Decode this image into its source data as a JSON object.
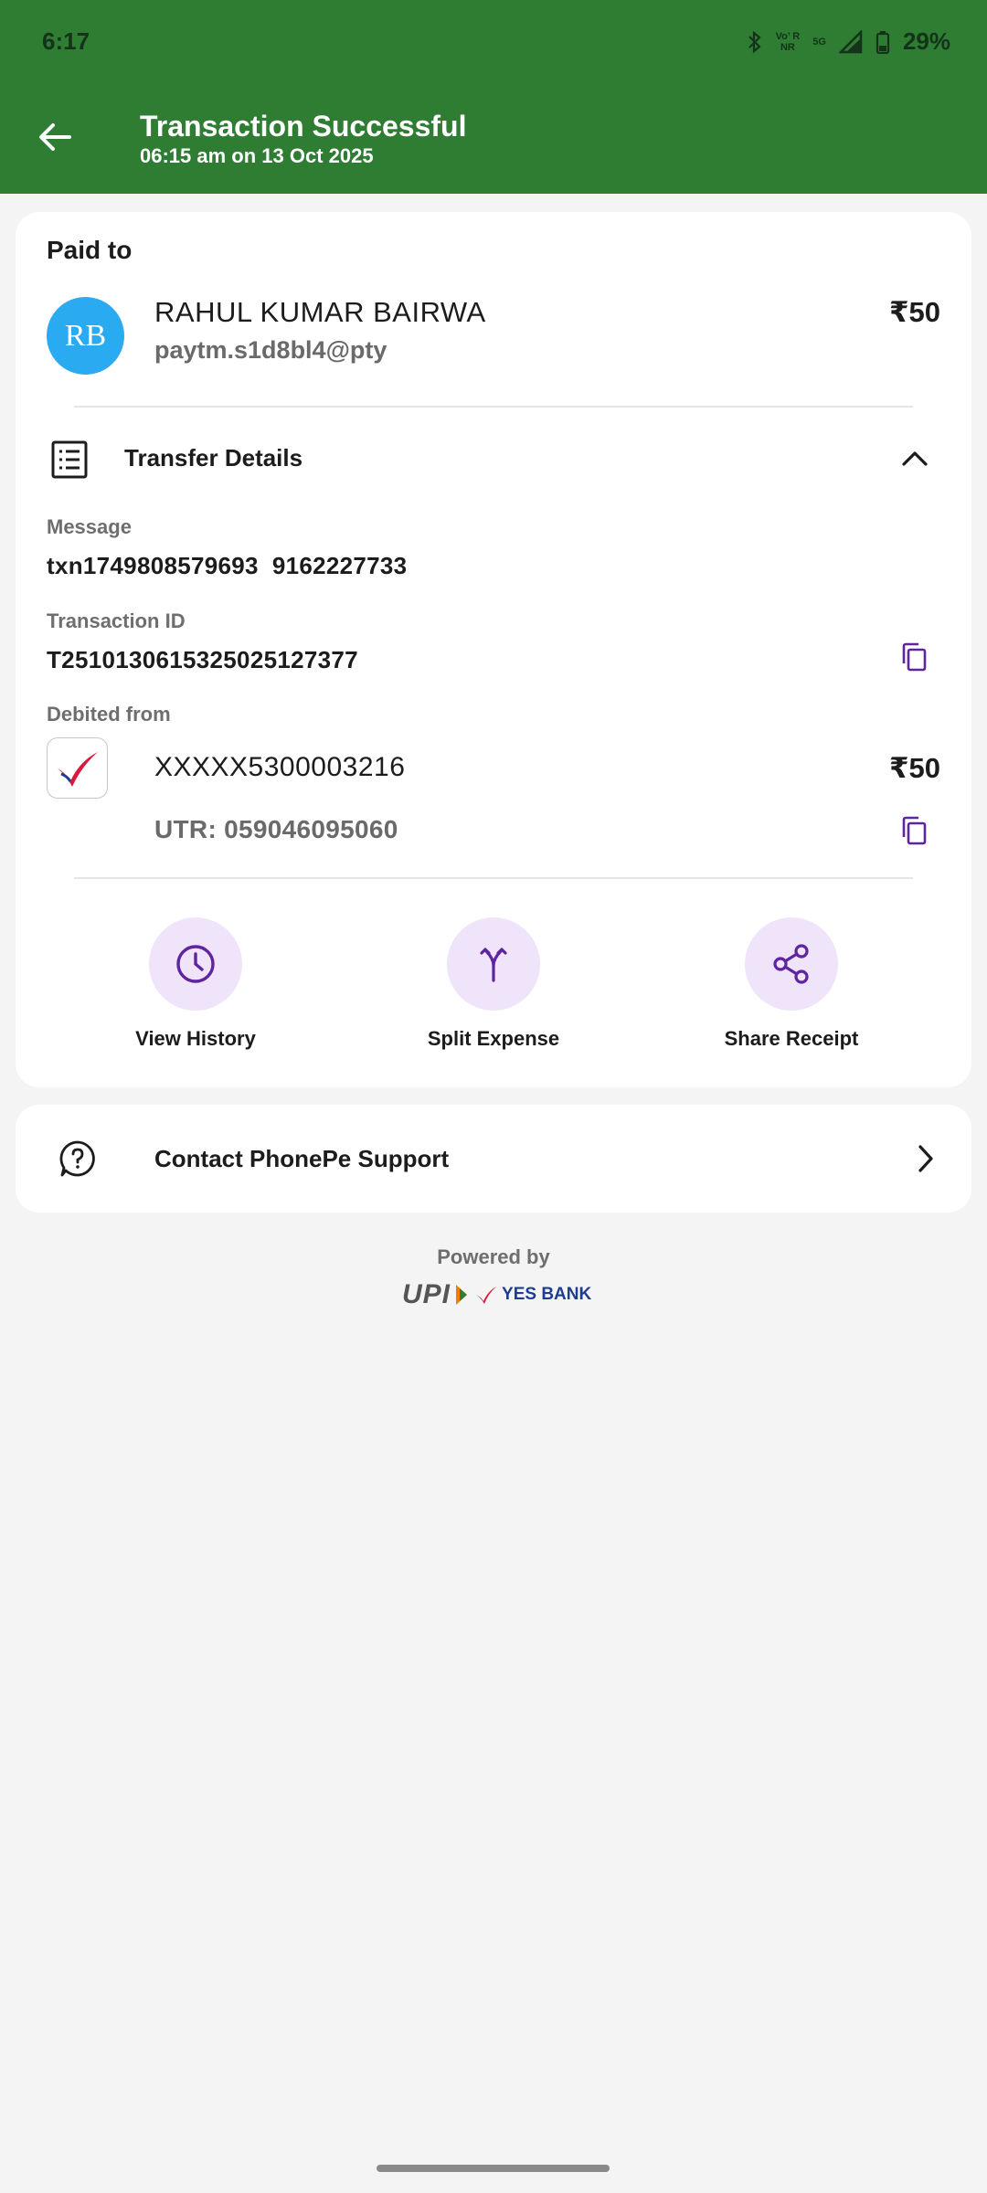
{
  "status_bar": {
    "time": "6:17",
    "network_small_top": "Vo’ R",
    "network_small_bottom": "NR",
    "network_5g": "5G",
    "battery": "29%"
  },
  "header": {
    "title": "Transaction Successful",
    "subtitle": "06:15 am on 13 Oct 2025"
  },
  "payee": {
    "section_label": "Paid to",
    "initials": "RB",
    "name": "RAHUL KUMAR BAIRWA",
    "vpa": "paytm.s1d8bl4@pty",
    "amount": "₹50"
  },
  "transfer_details": {
    "title": "Transfer Details",
    "message_label": "Message",
    "message_value": "txn1749808579693  9162227733",
    "txn_id_label": "Transaction ID",
    "txn_id_value": "T2510130615325025127377",
    "debited_label": "Debited from",
    "account": "XXXXX5300003216",
    "debit_amount": "₹50",
    "utr": "UTR: 059046095060"
  },
  "actions": [
    {
      "label": "View History",
      "icon": "clock-icon"
    },
    {
      "label": "Split Expense",
      "icon": "split-icon"
    },
    {
      "label": "Share Receipt",
      "icon": "share-icon"
    }
  ],
  "support": {
    "label": "Contact PhonePe Support"
  },
  "footer": {
    "powered_by": "Powered by",
    "upi_logo_text": "UPI",
    "bank_logo_text": "YES BANK"
  },
  "colors": {
    "header_green": "#2e7d32",
    "accent_purple": "#5f259f",
    "action_bg": "#f0e4fa",
    "avatar_blue": "#2aaaf0"
  }
}
